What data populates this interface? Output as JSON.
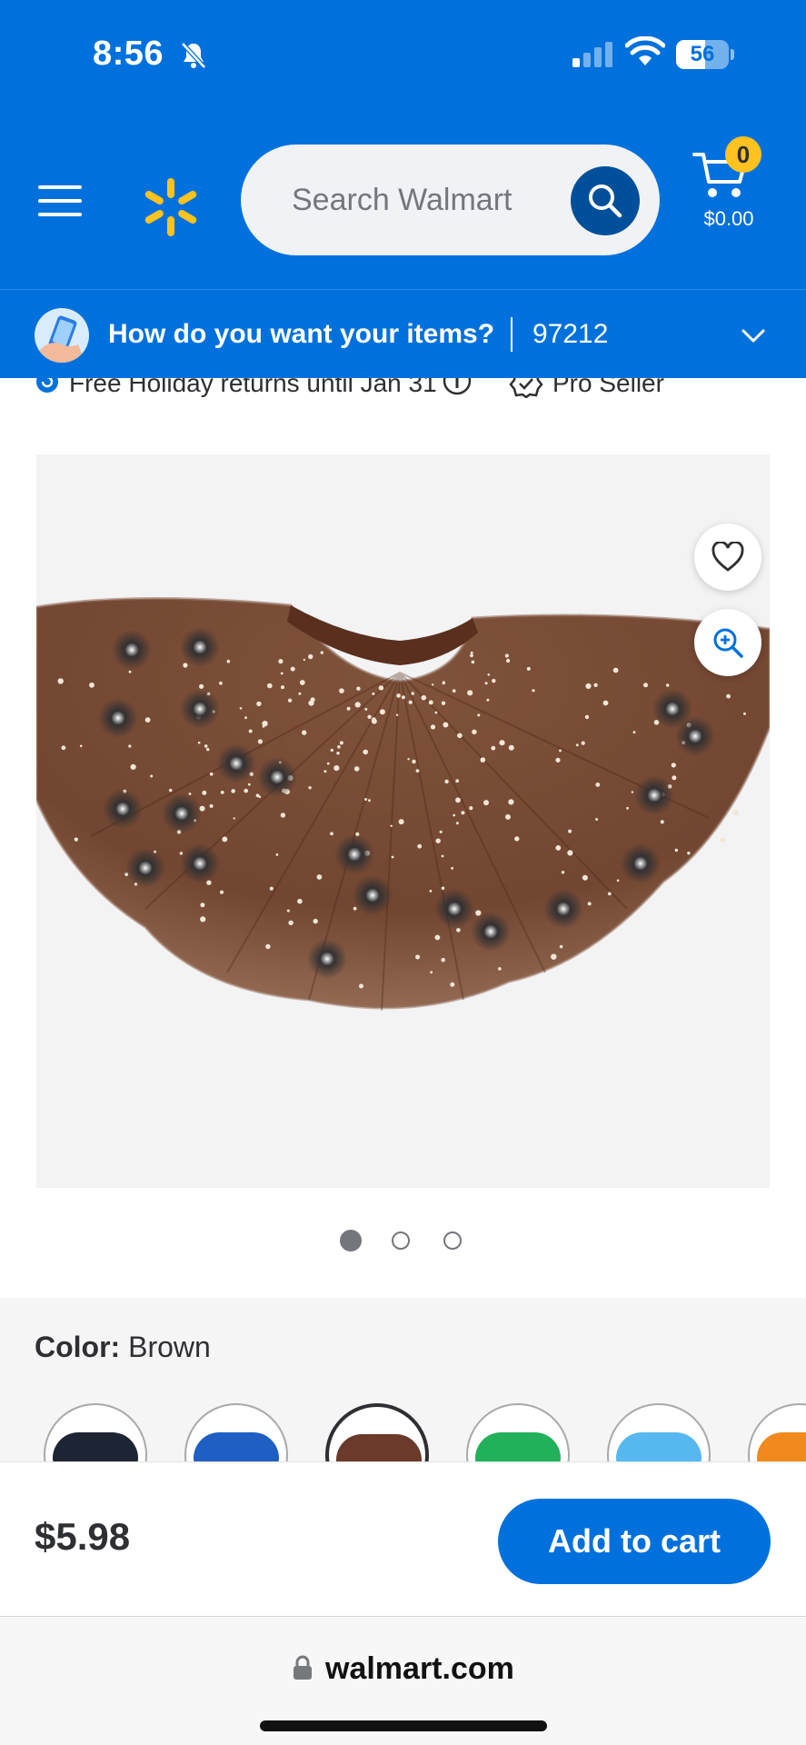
{
  "status_bar": {
    "time": "8:56",
    "battery": "56",
    "battery_level": 0.56
  },
  "header": {
    "search": {
      "placeholder": "Search Walmart"
    },
    "cart": {
      "count": "0",
      "total": "$0.00"
    }
  },
  "delivery": {
    "question": "How do you want your items?",
    "zip": "97212"
  },
  "info": {
    "returns": "Free Holiday returns until Jan 31",
    "seller": "Pro Seller"
  },
  "gallery": {
    "page_count": 3,
    "active_index": 0
  },
  "color": {
    "label": "Color:",
    "value": "Brown",
    "swatches": [
      {
        "name": "Black",
        "color": "#1d2433"
      },
      {
        "name": "Blue",
        "color": "#1f5fc4"
      },
      {
        "name": "Brown",
        "color": "#6b3a2a",
        "selected": true
      },
      {
        "name": "Green",
        "color": "#23b05a"
      },
      {
        "name": "Light Blue",
        "color": "#56b8ee"
      },
      {
        "name": "Orange",
        "color": "#f08a1c"
      }
    ]
  },
  "buy": {
    "price": "$5.98",
    "button": "Add to cart"
  },
  "browser": {
    "url": "walmart.com"
  },
  "colors": {
    "brand_blue": "#0071dc",
    "dark_blue": "#004f9a",
    "spark_yellow": "#ffc220",
    "skirt_brown": "#6e4029"
  }
}
